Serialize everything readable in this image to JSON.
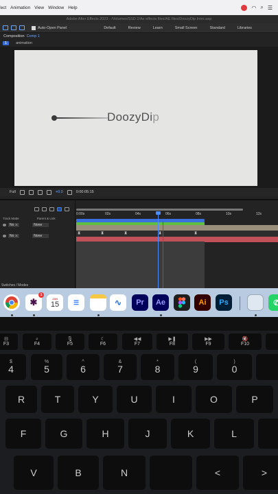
{
  "menubar": {
    "items": [
      "ffect",
      "Animation",
      "View",
      "Window",
      "Help"
    ]
  },
  "app": {
    "title": "Adobe After Effects 2023 - /Volumes/SSD 2/Ae effects files/AE files/DoozyDip Intro.aep",
    "toolbar": {
      "auto_open_label": "Auto-Open Panel",
      "workspaces": [
        "Default",
        "Review",
        "Learn",
        "Small Screen",
        "Standard",
        "Libraries"
      ]
    },
    "composition": {
      "tab_label": "Composition",
      "comp_name": "Comp 1",
      "sub_label_badge": "1",
      "sub_label": "animation"
    },
    "canvas": {
      "logo_text_main": "DoozyDi",
      "logo_text_fade": "p"
    },
    "viewer_bar": {
      "quality": "Full",
      "exposure": "+0.0",
      "timecode": "0:00:05:15"
    },
    "timeline": {
      "headers": {
        "track_matte": "Track Matte",
        "parent_link": "Parent & Link"
      },
      "layers": [
        {
          "mode": "No ⚔",
          "parent": "None"
        },
        {
          "mode": "No ⚔",
          "parent": "None"
        }
      ],
      "ruler": [
        "0:00s",
        "02s",
        "04s",
        "06s",
        "08s",
        "10s",
        "12s"
      ],
      "status_label": "Switches / Modes"
    }
  },
  "dock": {
    "calendar_month": "JAN",
    "calendar_day": "15",
    "slack_badge": "1",
    "apps": [
      {
        "name": "chrome",
        "label": ""
      },
      {
        "name": "slack",
        "label": ""
      },
      {
        "name": "calendar",
        "label": ""
      },
      {
        "name": "reminders",
        "label": ""
      },
      {
        "name": "notes",
        "label": ""
      },
      {
        "name": "freeform",
        "label": ""
      },
      {
        "name": "premiere",
        "label": "Pr"
      },
      {
        "name": "after-effects",
        "label": "Ae"
      },
      {
        "name": "figma",
        "label": ""
      },
      {
        "name": "illustrator",
        "label": "Ai"
      },
      {
        "name": "photoshop",
        "label": "Ps"
      }
    ]
  },
  "keyboard": {
    "fn_row": [
      "F3",
      "F4",
      "F5",
      "F6",
      "F7",
      "F8",
      "F9",
      "F10"
    ],
    "num_row": [
      {
        "top": "$",
        "main": "4"
      },
      {
        "top": "%",
        "main": "5"
      },
      {
        "top": "^",
        "main": "6"
      },
      {
        "top": "&",
        "main": "7"
      },
      {
        "top": "*",
        "main": "8"
      },
      {
        "top": "(",
        "main": "9"
      },
      {
        "top": ")",
        "main": "0"
      }
    ],
    "row_q": [
      "R",
      "T",
      "Y",
      "U",
      "I",
      "O",
      "P"
    ],
    "row_a": [
      "F",
      "G",
      "H",
      "J",
      "K",
      "L"
    ],
    "row_z": [
      "V",
      "B",
      "N"
    ]
  }
}
